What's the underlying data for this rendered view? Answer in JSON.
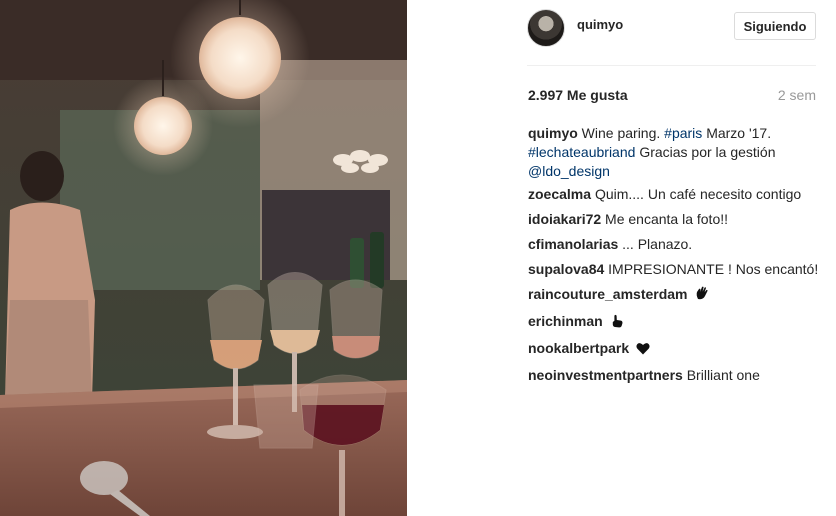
{
  "post": {
    "author": "quimyo",
    "follow_label": "Siguiendo",
    "likes": "2.997 Me gusta",
    "time_ago": "2 sem",
    "caption": {
      "user": "quimyo",
      "text_a": "Wine paring.",
      "tag_paris": "#paris",
      "text_b": "Marzo '17.",
      "tag_chateau": "#lechateaubriand",
      "text_c": "Gracias por la gestión",
      "mention": "@ldo_design"
    }
  },
  "comments": [
    {
      "user": "zoecalma",
      "text": "Quim.... Un café necesito contigo"
    },
    {
      "user": "idoiakari72",
      "text": "Me encanta la foto!!"
    },
    {
      "user": "cfimanolarias",
      "text": "... Planazo."
    },
    {
      "user": "supalova84",
      "text": "IMPRESIONANTE ! Nos encantó!"
    },
    {
      "user": "raincouture_amsterdam",
      "emoji": "waving-hand-icon"
    },
    {
      "user": "erichinman",
      "emoji": "pointing-hand-icon"
    },
    {
      "user": "nookalbertpark",
      "emoji": "heart-icon"
    },
    {
      "user": "neoinvestmentpartners",
      "text": "Brilliant one"
    }
  ],
  "colors": {
    "link": "#003569",
    "muted": "#999999",
    "border": "#dbdbdb"
  }
}
